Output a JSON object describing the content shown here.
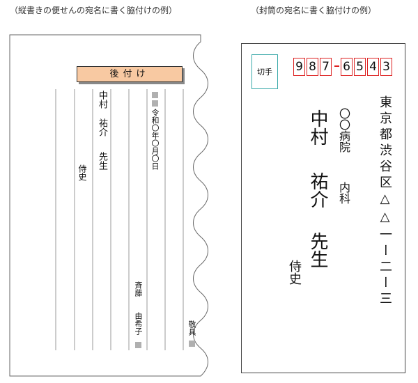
{
  "captions": {
    "left": "（縦書きの便せんの宛名に書く脇付けの例）",
    "right": "（封筒の宛名に書く脇付けの例）"
  },
  "letter": {
    "label": "後付け",
    "date": "令和〇年〇月〇日",
    "sender": [
      "斉藤",
      "由希子"
    ],
    "recipient": [
      "中村",
      "祐介",
      "先生"
    ],
    "wakizuke": "侍史",
    "closing": "敬具"
  },
  "envelope": {
    "stamp": "切手",
    "zip": [
      "9",
      "8",
      "7",
      "6",
      "5",
      "4",
      "3"
    ],
    "address": "東京都渋谷区△△一ー二ー三",
    "organization": [
      "〇〇病院",
      "内科"
    ],
    "recipient": [
      "中村",
      "祐介",
      "先生"
    ],
    "wakizuke": "侍史"
  },
  "colors": {
    "label_bg": "#f8c9a2",
    "zip_border": "#dd2222",
    "stamp_border": "#39a9a9"
  }
}
